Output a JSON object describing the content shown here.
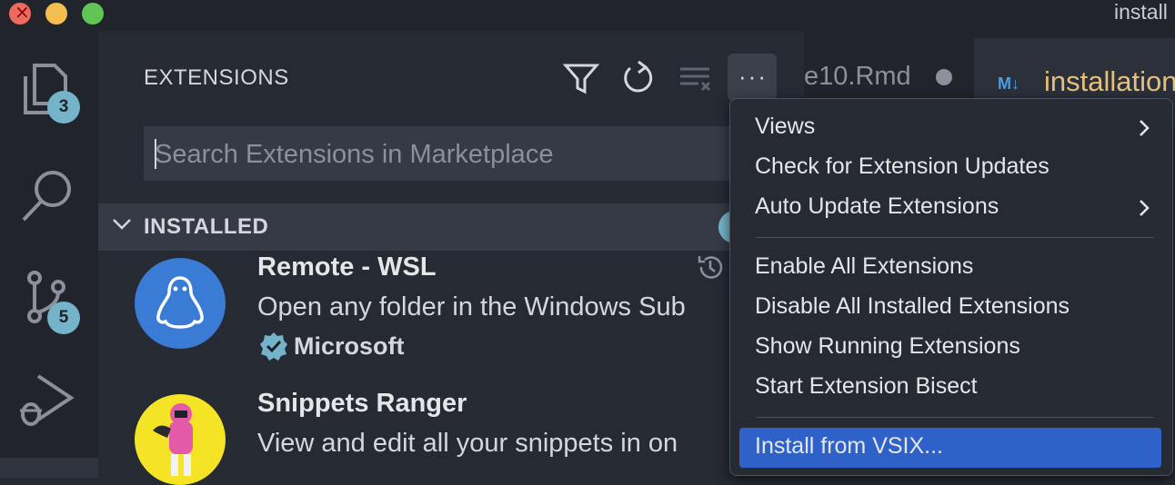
{
  "window": {
    "title": "install"
  },
  "activity_bar": {
    "explorer_badge": "3",
    "source_control_badge": "5"
  },
  "sidebar": {
    "title": "EXTENSIONS",
    "search": {
      "placeholder": "Search Extensions in Marketplace",
      "value": ""
    },
    "section": {
      "label": "INSTALLED"
    },
    "extensions": [
      {
        "name": "Remote - WSL",
        "description": "Open any folder in the Windows Sub",
        "publisher": "Microsoft",
        "verified": true
      },
      {
        "name": "Snippets Ranger",
        "description": "View and edit all your snippets in on",
        "publisher": ""
      }
    ]
  },
  "editor_tabs": [
    {
      "label": "e10.Rmd",
      "dirty": true
    },
    {
      "label": "installation",
      "icon_text": "M↓",
      "active": true
    }
  ],
  "context_menu": {
    "groups": [
      [
        {
          "label": "Views",
          "submenu": true
        },
        {
          "label": "Check for Extension Updates",
          "submenu": false
        },
        {
          "label": "Auto Update Extensions",
          "submenu": true
        }
      ],
      [
        {
          "label": "Enable All Extensions",
          "submenu": false
        },
        {
          "label": "Disable All Installed Extensions",
          "submenu": false
        },
        {
          "label": "Show Running Extensions",
          "submenu": false
        },
        {
          "label": "Start Extension Bisect",
          "submenu": false
        }
      ],
      [
        {
          "label": "Install from VSIX...",
          "submenu": false,
          "highlighted": true
        }
      ]
    ]
  },
  "colors": {
    "accent": "#2f62c8",
    "badge": "#74b3c9",
    "active_tab_text": "#e5c07b"
  }
}
